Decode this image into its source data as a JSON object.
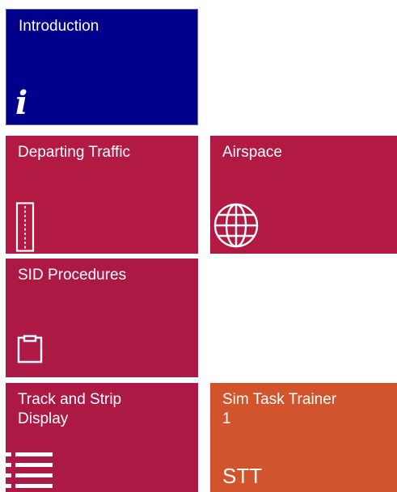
{
  "tiles": {
    "introduction": {
      "label": "Introduction",
      "icon": "info-icon",
      "glyph": "i",
      "color": "#00008b"
    },
    "departing_traffic": {
      "label": "Departing Traffic",
      "icon": "runway-strip-icon",
      "color": "#b31a43"
    },
    "airspace": {
      "label": "Airspace",
      "icon": "globe-icon",
      "color": "#b31a43"
    },
    "sid_procedures": {
      "label": "SID Procedures",
      "icon": "clipboard-icon",
      "color": "#ad1945"
    },
    "track_and_strip": {
      "label": "Track and Strip\nDisplay",
      "icon": "list-icon",
      "color": "#ad1945"
    },
    "sim_task_trainer": {
      "label": "Sim Task Trainer\n1",
      "icon": "stt-text-icon",
      "glyph": "STT",
      "color": "#d2542c"
    }
  }
}
